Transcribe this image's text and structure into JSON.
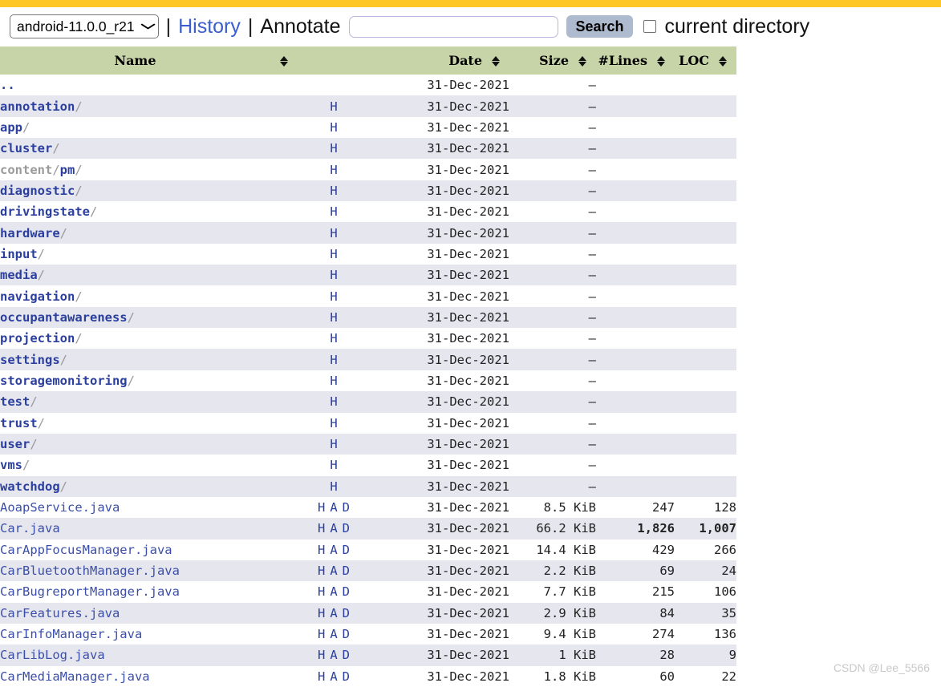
{
  "theme": {
    "accent_bar": "#ffc726",
    "table_header_bg": "#c6d4a8",
    "row_alt_bg": "#e6e6ef",
    "link": "#2b3f9e",
    "search_button_bg": "#aebacd"
  },
  "toolbar": {
    "branch_value": "android-11.0.0_r21",
    "branch_options": [
      "android-11.0.0_r21"
    ],
    "chevron": "⌄",
    "separator1": "|",
    "history_label": "History",
    "separator2": "|",
    "annotate_label": "Annotate",
    "search_value": "",
    "search_placeholder": "",
    "search_button_label": "Search",
    "current_directory_label": "current directory",
    "current_directory_checked": false
  },
  "table": {
    "columns": [
      {
        "key": "name",
        "label": "Name",
        "sortable": true
      },
      {
        "key": "date",
        "label": "Date",
        "sortable": true
      },
      {
        "key": "size",
        "label": "Size",
        "sortable": true
      },
      {
        "key": "lines",
        "label": "#Lines",
        "sortable": true
      },
      {
        "key": "loc",
        "label": "LOC",
        "sortable": true
      }
    ],
    "sort_icon": "sort-updown-icon",
    "rows": [
      {
        "type": "parent",
        "name": "..",
        "suffix": "",
        "links": [],
        "date": "31-Dec-2021",
        "size": "–",
        "lines": "",
        "loc": "",
        "bold_numbers": false
      },
      {
        "type": "dir",
        "name": "annotation",
        "suffix": "/",
        "links": [
          "H"
        ],
        "date": "31-Dec-2021",
        "size": "–",
        "lines": "",
        "loc": "",
        "bold_numbers": false
      },
      {
        "type": "dir",
        "name": "app",
        "suffix": "/",
        "links": [
          "H"
        ],
        "date": "31-Dec-2021",
        "size": "–",
        "lines": "",
        "loc": "",
        "bold_numbers": false
      },
      {
        "type": "dir",
        "name": "cluster",
        "suffix": "/",
        "links": [
          "H"
        ],
        "date": "31-Dec-2021",
        "size": "–",
        "lines": "",
        "loc": "",
        "bold_numbers": false
      },
      {
        "type": "dir",
        "name": "content",
        "muted": true,
        "sub": "pm",
        "suffix": "/",
        "links": [
          "H"
        ],
        "date": "31-Dec-2021",
        "size": "–",
        "lines": "",
        "loc": "",
        "bold_numbers": false
      },
      {
        "type": "dir",
        "name": "diagnostic",
        "suffix": "/",
        "links": [
          "H"
        ],
        "date": "31-Dec-2021",
        "size": "–",
        "lines": "",
        "loc": "",
        "bold_numbers": false
      },
      {
        "type": "dir",
        "name": "drivingstate",
        "suffix": "/",
        "links": [
          "H"
        ],
        "date": "31-Dec-2021",
        "size": "–",
        "lines": "",
        "loc": "",
        "bold_numbers": false
      },
      {
        "type": "dir",
        "name": "hardware",
        "suffix": "/",
        "links": [
          "H"
        ],
        "date": "31-Dec-2021",
        "size": "–",
        "lines": "",
        "loc": "",
        "bold_numbers": false
      },
      {
        "type": "dir",
        "name": "input",
        "suffix": "/",
        "links": [
          "H"
        ],
        "date": "31-Dec-2021",
        "size": "–",
        "lines": "",
        "loc": "",
        "bold_numbers": false
      },
      {
        "type": "dir",
        "name": "media",
        "suffix": "/",
        "links": [
          "H"
        ],
        "date": "31-Dec-2021",
        "size": "–",
        "lines": "",
        "loc": "",
        "bold_numbers": false
      },
      {
        "type": "dir",
        "name": "navigation",
        "suffix": "/",
        "links": [
          "H"
        ],
        "date": "31-Dec-2021",
        "size": "–",
        "lines": "",
        "loc": "",
        "bold_numbers": false
      },
      {
        "type": "dir",
        "name": "occupantawareness",
        "suffix": "/",
        "links": [
          "H"
        ],
        "date": "31-Dec-2021",
        "size": "–",
        "lines": "",
        "loc": "",
        "bold_numbers": false
      },
      {
        "type": "dir",
        "name": "projection",
        "suffix": "/",
        "links": [
          "H"
        ],
        "date": "31-Dec-2021",
        "size": "–",
        "lines": "",
        "loc": "",
        "bold_numbers": false
      },
      {
        "type": "dir",
        "name": "settings",
        "suffix": "/",
        "links": [
          "H"
        ],
        "date": "31-Dec-2021",
        "size": "–",
        "lines": "",
        "loc": "",
        "bold_numbers": false
      },
      {
        "type": "dir",
        "name": "storagemonitoring",
        "suffix": "/",
        "links": [
          "H"
        ],
        "date": "31-Dec-2021",
        "size": "–",
        "lines": "",
        "loc": "",
        "bold_numbers": false
      },
      {
        "type": "dir",
        "name": "test",
        "suffix": "/",
        "links": [
          "H"
        ],
        "date": "31-Dec-2021",
        "size": "–",
        "lines": "",
        "loc": "",
        "bold_numbers": false
      },
      {
        "type": "dir",
        "name": "trust",
        "suffix": "/",
        "links": [
          "H"
        ],
        "date": "31-Dec-2021",
        "size": "–",
        "lines": "",
        "loc": "",
        "bold_numbers": false
      },
      {
        "type": "dir",
        "name": "user",
        "suffix": "/",
        "links": [
          "H"
        ],
        "date": "31-Dec-2021",
        "size": "–",
        "lines": "",
        "loc": "",
        "bold_numbers": false
      },
      {
        "type": "dir",
        "name": "vms",
        "suffix": "/",
        "links": [
          "H"
        ],
        "date": "31-Dec-2021",
        "size": "–",
        "lines": "",
        "loc": "",
        "bold_numbers": false
      },
      {
        "type": "dir",
        "name": "watchdog",
        "suffix": "/",
        "links": [
          "H"
        ],
        "date": "31-Dec-2021",
        "size": "–",
        "lines": "",
        "loc": "",
        "bold_numbers": false
      },
      {
        "type": "file",
        "name": "AoapService.java",
        "suffix": "",
        "links": [
          "H",
          "A",
          "D"
        ],
        "date": "31-Dec-2021",
        "size": "8.5 KiB",
        "lines": "247",
        "loc": "128",
        "bold_numbers": false
      },
      {
        "type": "file",
        "name": "Car.java",
        "suffix": "",
        "links": [
          "H",
          "A",
          "D"
        ],
        "date": "31-Dec-2021",
        "size": "66.2 KiB",
        "lines": "1,826",
        "loc": "1,007",
        "bold_numbers": true
      },
      {
        "type": "file",
        "name": "CarAppFocusManager.java",
        "suffix": "",
        "links": [
          "H",
          "A",
          "D"
        ],
        "date": "31-Dec-2021",
        "size": "14.4 KiB",
        "lines": "429",
        "loc": "266",
        "bold_numbers": false
      },
      {
        "type": "file",
        "name": "CarBluetoothManager.java",
        "suffix": "",
        "links": [
          "H",
          "A",
          "D"
        ],
        "date": "31-Dec-2021",
        "size": "2.2 KiB",
        "lines": "69",
        "loc": "24",
        "bold_numbers": false
      },
      {
        "type": "file",
        "name": "CarBugreportManager.java",
        "suffix": "",
        "links": [
          "H",
          "A",
          "D"
        ],
        "date": "31-Dec-2021",
        "size": "7.7 KiB",
        "lines": "215",
        "loc": "106",
        "bold_numbers": false
      },
      {
        "type": "file",
        "name": "CarFeatures.java",
        "suffix": "",
        "links": [
          "H",
          "A",
          "D"
        ],
        "date": "31-Dec-2021",
        "size": "2.9 KiB",
        "lines": "84",
        "loc": "35",
        "bold_numbers": false
      },
      {
        "type": "file",
        "name": "CarInfoManager.java",
        "suffix": "",
        "links": [
          "H",
          "A",
          "D"
        ],
        "date": "31-Dec-2021",
        "size": "9.4 KiB",
        "lines": "274",
        "loc": "136",
        "bold_numbers": false
      },
      {
        "type": "file",
        "name": "CarLibLog.java",
        "suffix": "",
        "links": [
          "H",
          "A",
          "D"
        ],
        "date": "31-Dec-2021",
        "size": "1 KiB",
        "lines": "28",
        "loc": "9",
        "bold_numbers": false
      },
      {
        "type": "file",
        "name": "CarMediaManager.java",
        "suffix": "",
        "links": [
          "H",
          "A",
          "D"
        ],
        "date": "31-Dec-2021",
        "size": "1.8 KiB",
        "lines": "60",
        "loc": "22",
        "bold_numbers": false
      }
    ]
  },
  "watermark": "CSDN @Lee_5566"
}
